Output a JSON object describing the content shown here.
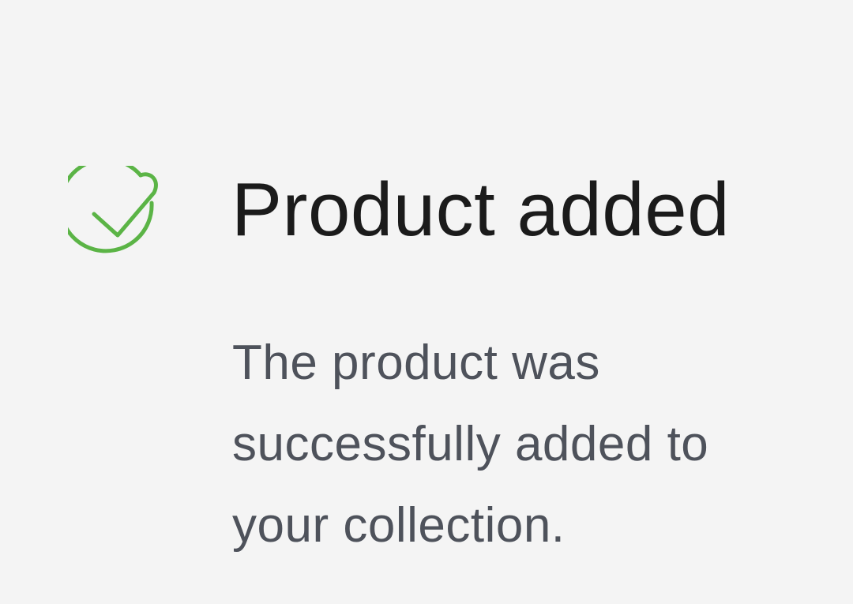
{
  "notification": {
    "icon": "check-circle-icon",
    "accent_color": "#5bb446",
    "title": "Product added",
    "message_lines": [
      "The product was",
      "successfully added to",
      "your collection."
    ]
  }
}
